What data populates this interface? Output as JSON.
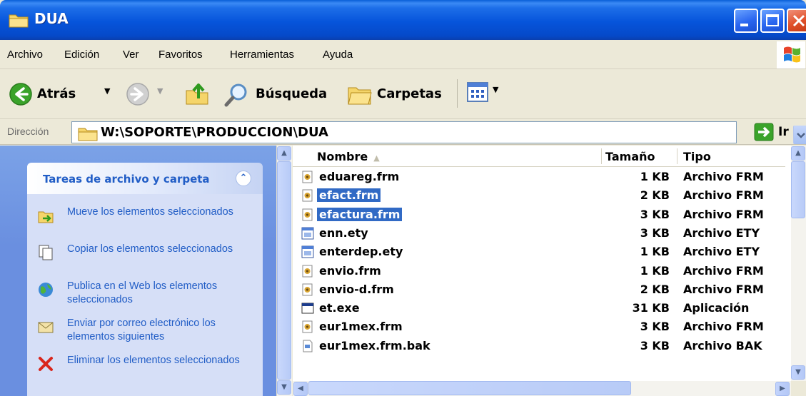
{
  "window": {
    "title": "DUA"
  },
  "menu": {
    "items": [
      "Archivo",
      "Edición",
      "Ver",
      "Favoritos",
      "Herramientas",
      "Ayuda"
    ]
  },
  "toolbar": {
    "back_label": "Atrás",
    "search_label": "Búsqueda",
    "folders_label": "Carpetas"
  },
  "address": {
    "label": "Dirección",
    "path": "W:\\SOPORTE\\PRODUCCION\\DUA",
    "go_label": "Ir"
  },
  "task_pane": {
    "title": "Tareas de archivo y carpeta",
    "items": [
      {
        "icon": "move-icon",
        "label": "Mueve los elementos seleccionados"
      },
      {
        "icon": "copy-icon",
        "label": "Copiar los elementos seleccionados"
      },
      {
        "icon": "web-publish-icon",
        "label": "Publica en el Web los elementos seleccionados"
      },
      {
        "icon": "email-icon",
        "label": "Enviar por correo electrónico los elementos siguientes"
      },
      {
        "icon": "delete-icon",
        "label": "Eliminar los elementos seleccionados"
      }
    ]
  },
  "file_list": {
    "columns": {
      "name": "Nombre",
      "size": "Tamaño",
      "type": "Tipo"
    },
    "rows": [
      {
        "name": "eduareg.frm",
        "size": "1 KB",
        "type": "Archivo FRM",
        "icon": "frm-file-icon",
        "selected": false
      },
      {
        "name": "efact.frm",
        "size": "2 KB",
        "type": "Archivo FRM",
        "icon": "frm-file-icon",
        "selected": true
      },
      {
        "name": "efactura.frm",
        "size": "3 KB",
        "type": "Archivo FRM",
        "icon": "frm-file-icon",
        "selected": true
      },
      {
        "name": "enn.ety",
        "size": "3 KB",
        "type": "Archivo ETY",
        "icon": "ety-file-icon",
        "selected": false
      },
      {
        "name": "enterdep.ety",
        "size": "1 KB",
        "type": "Archivo ETY",
        "icon": "ety-file-icon",
        "selected": false
      },
      {
        "name": "envio.frm",
        "size": "1 KB",
        "type": "Archivo FRM",
        "icon": "frm-file-icon",
        "selected": false
      },
      {
        "name": "envio-d.frm",
        "size": "2 KB",
        "type": "Archivo FRM",
        "icon": "frm-file-icon",
        "selected": false
      },
      {
        "name": "et.exe",
        "size": "31 KB",
        "type": "Aplicación",
        "icon": "exe-file-icon",
        "selected": false
      },
      {
        "name": "eur1mex.frm",
        "size": "3 KB",
        "type": "Archivo FRM",
        "icon": "frm-file-icon",
        "selected": false
      },
      {
        "name": "eur1mex.frm.bak",
        "size": "3 KB",
        "type": "Archivo BAK",
        "icon": "bak-file-icon",
        "selected": false
      }
    ]
  },
  "colors": {
    "titlebar": "#0654db",
    "selection": "#316ac5",
    "task_link": "#215dc6",
    "task_pane_bg": "#6a8fe0"
  }
}
